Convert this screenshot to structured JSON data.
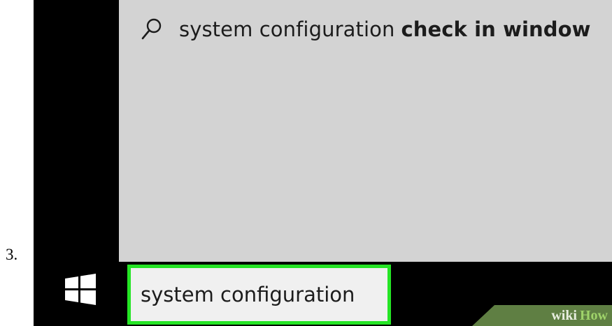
{
  "step": {
    "number": "3."
  },
  "search_panel": {
    "suggestion": {
      "icon": "search-icon",
      "typed_text": "system configuration",
      "completion_text": "check in window"
    }
  },
  "taskbar": {
    "start_icon": "windows-logo-icon",
    "search_box": {
      "value": "system configuration",
      "highlight_color": "#25e525"
    }
  },
  "watermark": {
    "part1": "wiki",
    "part2": "How"
  },
  "colors": {
    "panel_background": "#d3d3d3",
    "taskbar_background": "#000000",
    "search_box_background": "#f0f0f0",
    "watermark_background": "#5f7f43"
  }
}
